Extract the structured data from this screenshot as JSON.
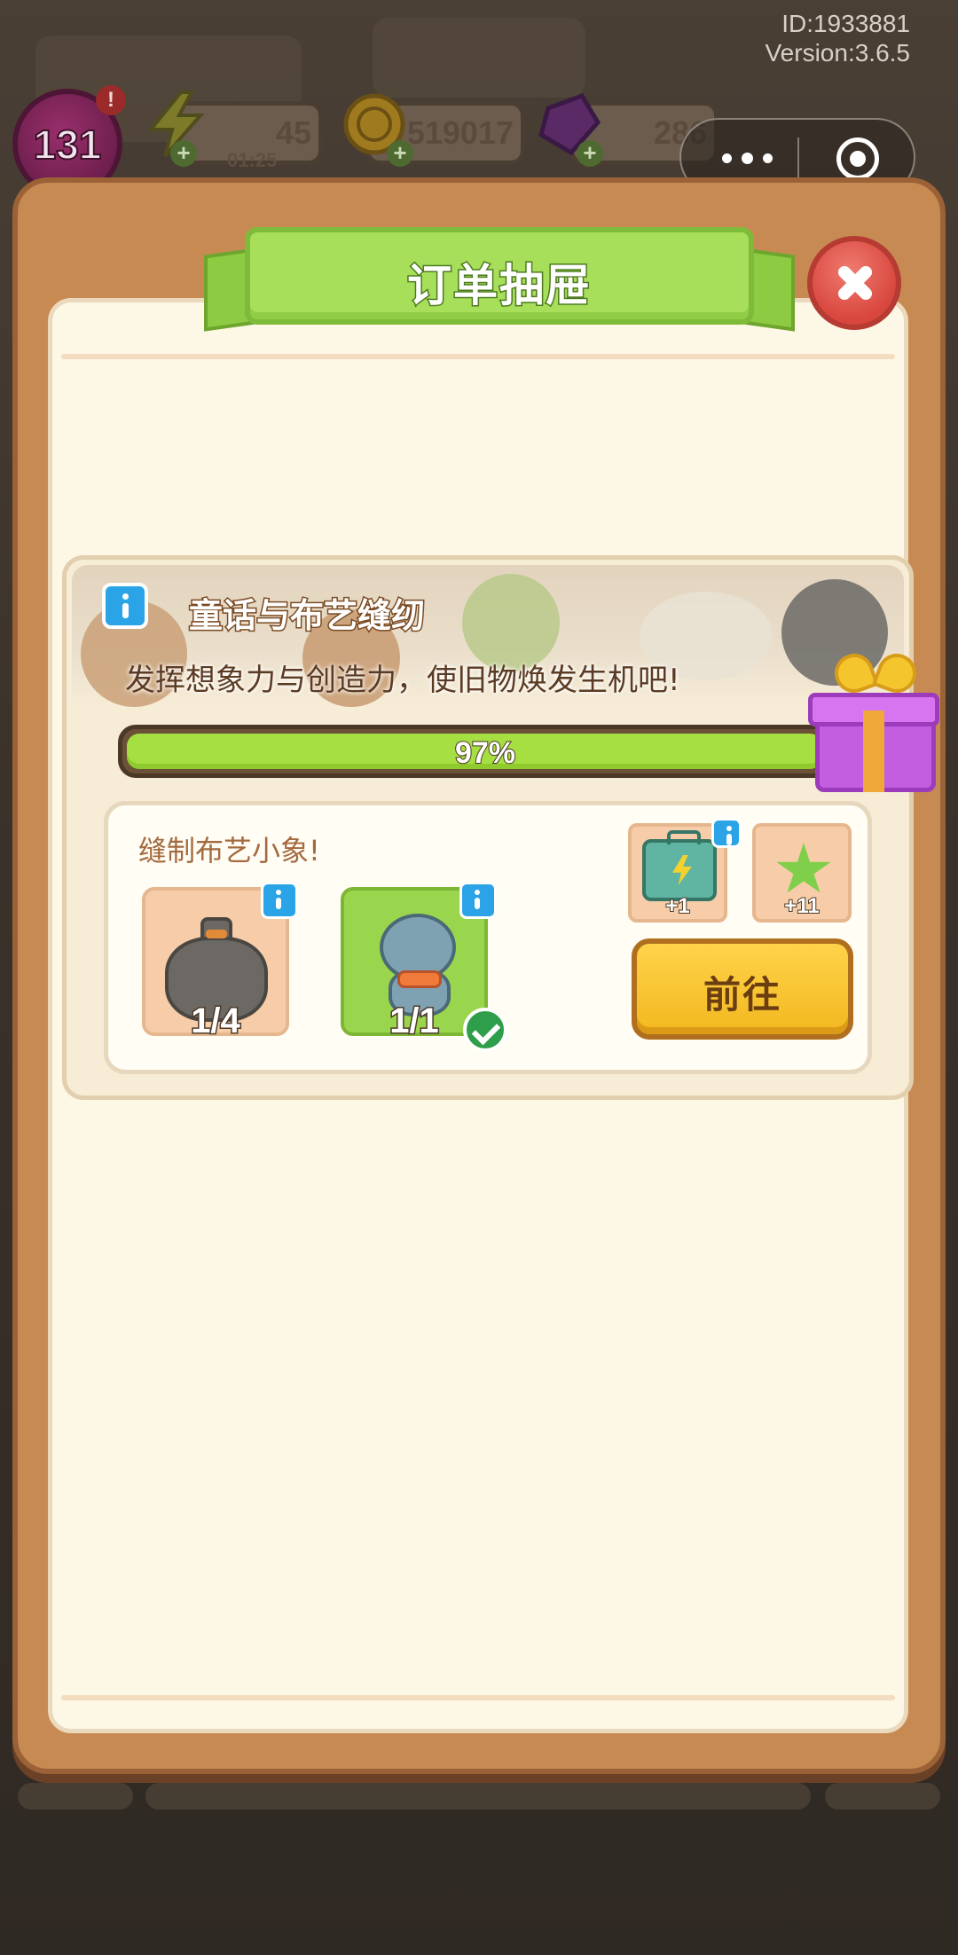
{
  "meta": {
    "id_text": "ID:1933881",
    "version_text": "Version:3.6.5"
  },
  "hud": {
    "level": "131",
    "alert": "!",
    "energy": "45",
    "energy_timer": "01:25",
    "coins": "519017",
    "gems": "286",
    "plus": "+"
  },
  "modal": {
    "title": "订单抽屉"
  },
  "drawer": {
    "title": "童话与布艺缝纫",
    "description": "发挥想象力与创造力，使旧物焕发生机吧!",
    "progress_label": "97%",
    "progress_fraction": 0.97
  },
  "order": {
    "task": "缝制布艺小象!",
    "items": [
      {
        "name": "garbage-bag",
        "count": "1/4",
        "done": false
      },
      {
        "name": "fabric-elephant",
        "count": "1/1",
        "done": true
      }
    ],
    "rewards": [
      {
        "name": "energy-case",
        "count": "+1"
      },
      {
        "name": "green-star",
        "count": "+11"
      }
    ],
    "go_label": "前往"
  },
  "colors": {
    "modal_frame": "#c78a52",
    "panel_bg": "#fdf7e6",
    "banner_green": "#a7de5a",
    "progress_green": "#a6df42",
    "button_yellow": "#ffd34a",
    "close_red": "#d8463d"
  }
}
